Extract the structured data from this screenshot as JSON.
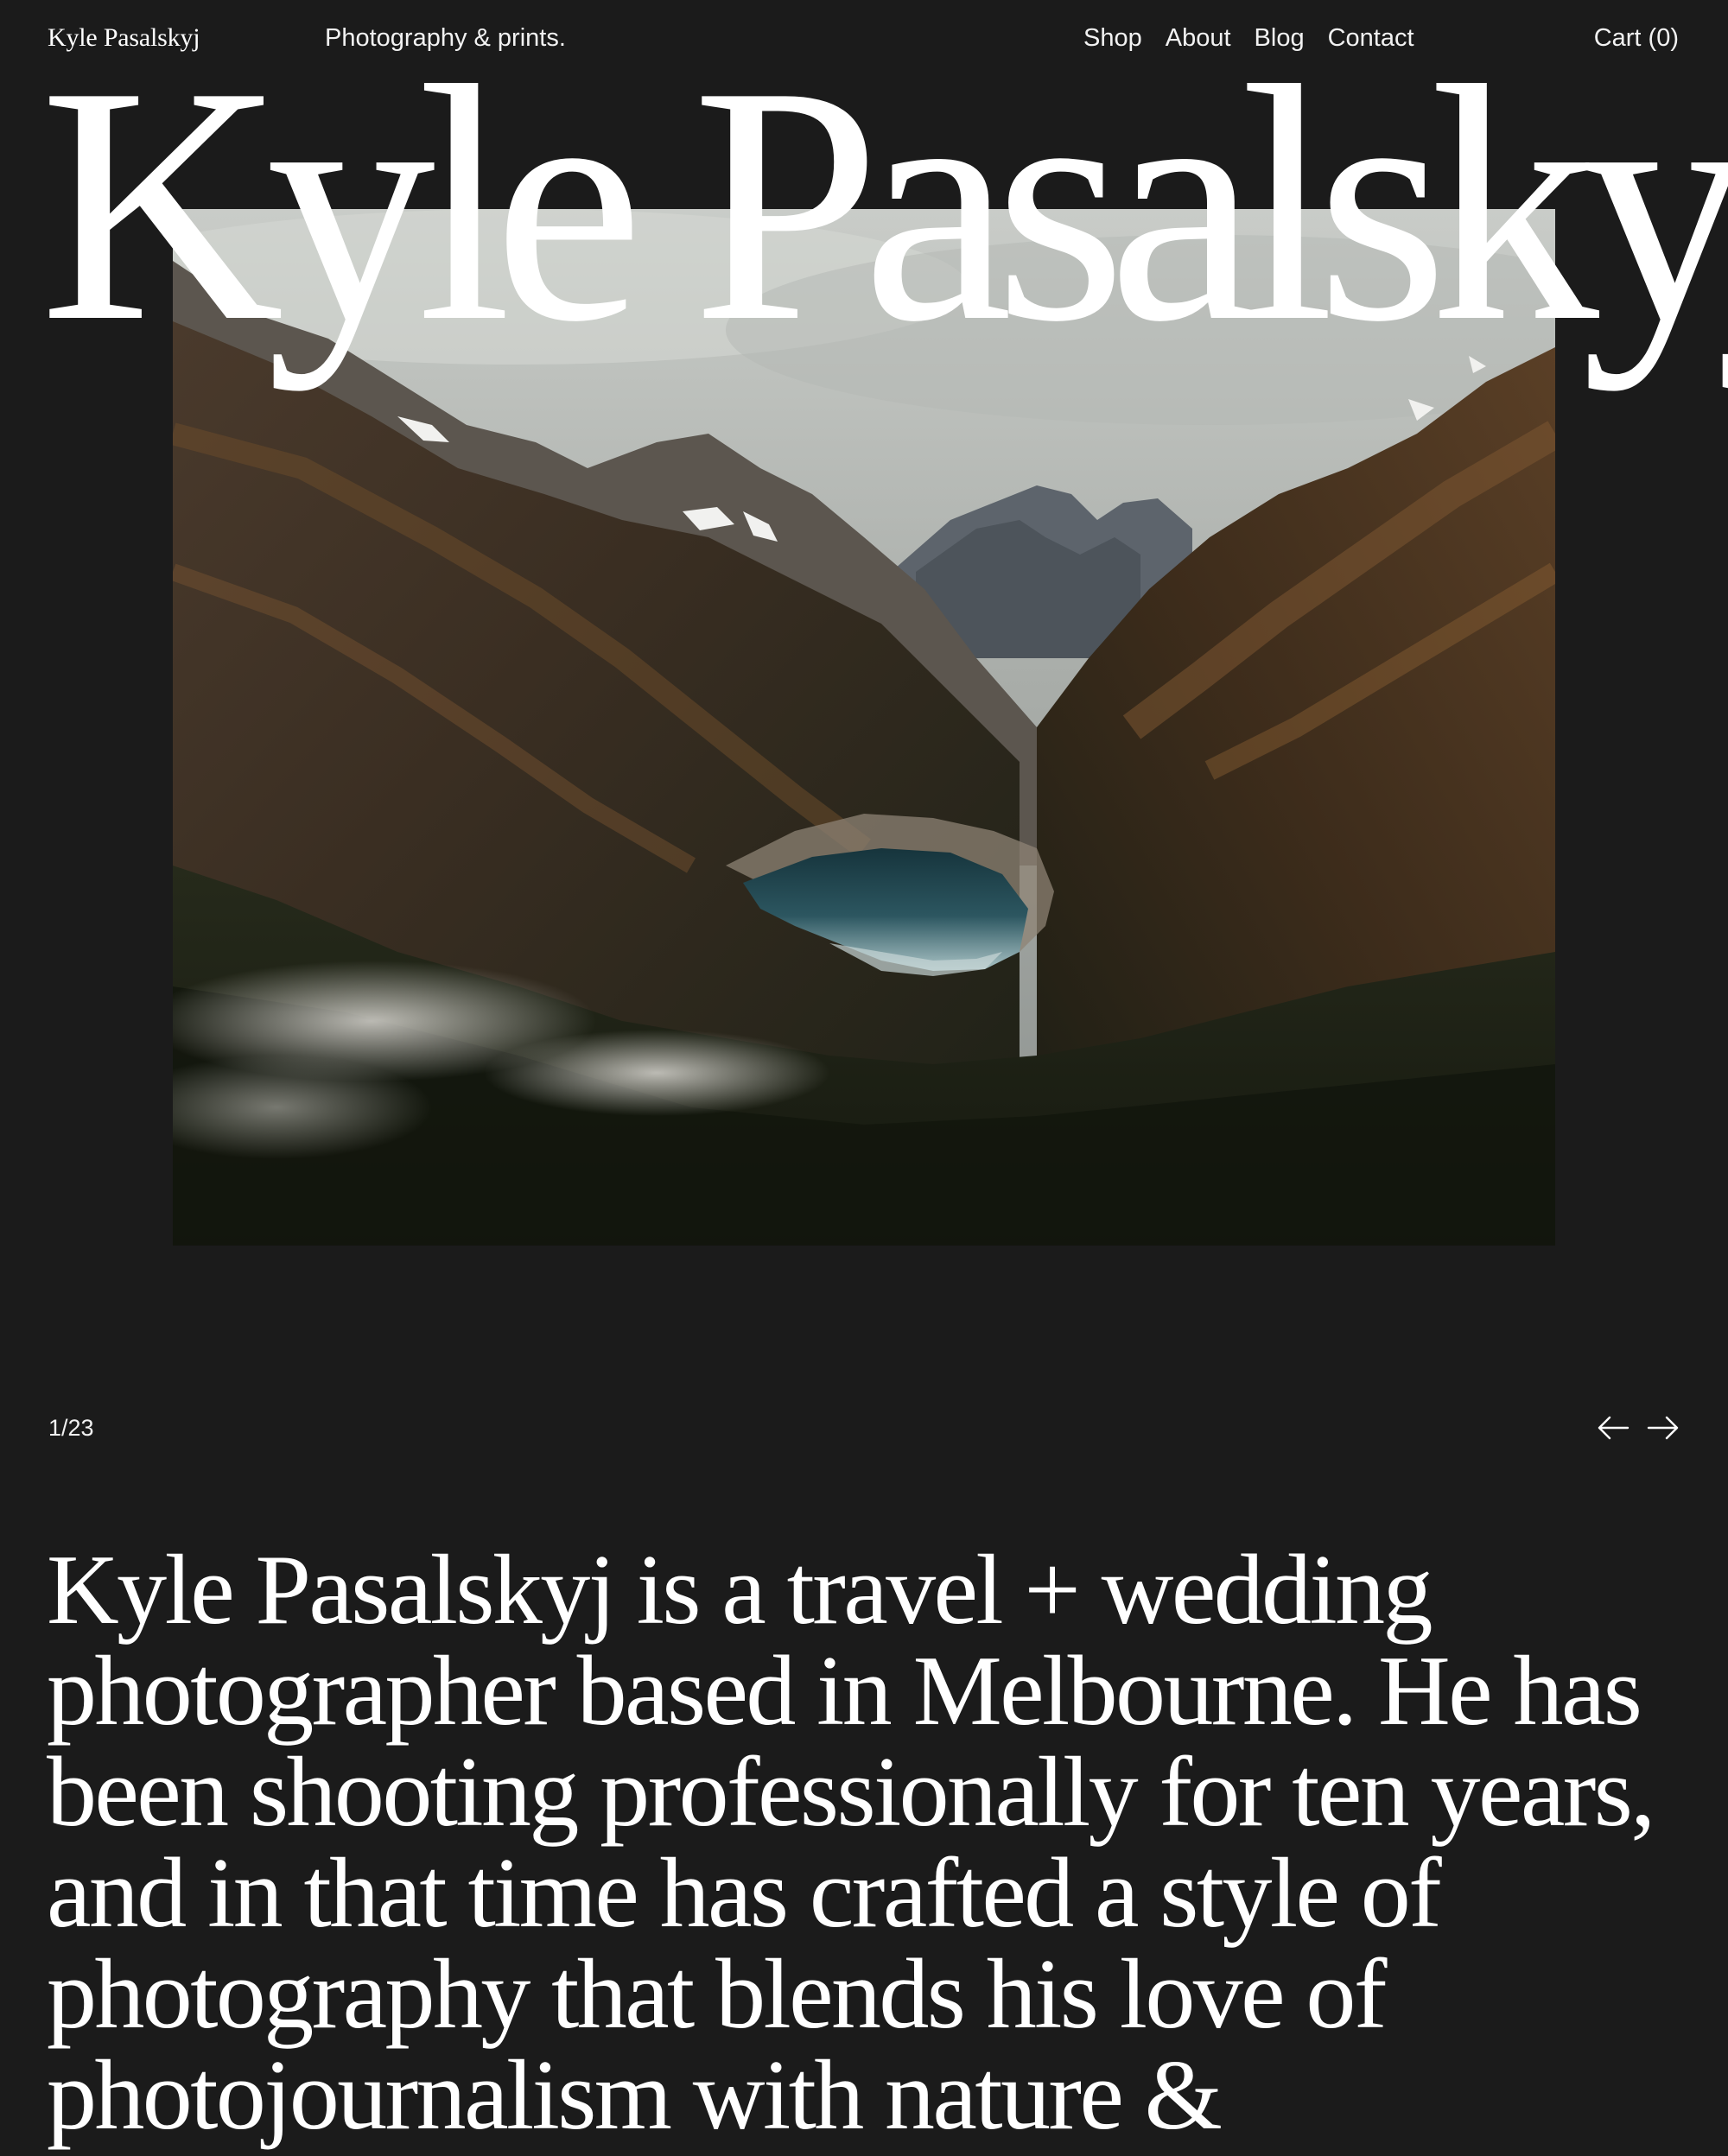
{
  "header": {
    "logo": "Kyle Pasalskyj",
    "tagline": "Photography & prints.",
    "nav": [
      {
        "label": "Shop"
      },
      {
        "label": "About"
      },
      {
        "label": "Blog"
      },
      {
        "label": "Contact"
      }
    ],
    "cart_label": "Cart (0)"
  },
  "hero": {
    "title": "Kyle Pasalskyj",
    "image_subject": "mountain valley with alpine lake"
  },
  "slider": {
    "counter": "1/23",
    "prev_icon": "arrow-left-icon",
    "next_icon": "arrow-right-icon"
  },
  "bio": {
    "text": "Kyle Pasalskyj is a travel + wedding photographer based in Melbourne. He has been shooting professionally for ten years, and in that time has crafted a style of photography that blends his love of photojournalism with nature &"
  },
  "colors": {
    "background": "#1b1b1b",
    "text": "#ffffff"
  }
}
